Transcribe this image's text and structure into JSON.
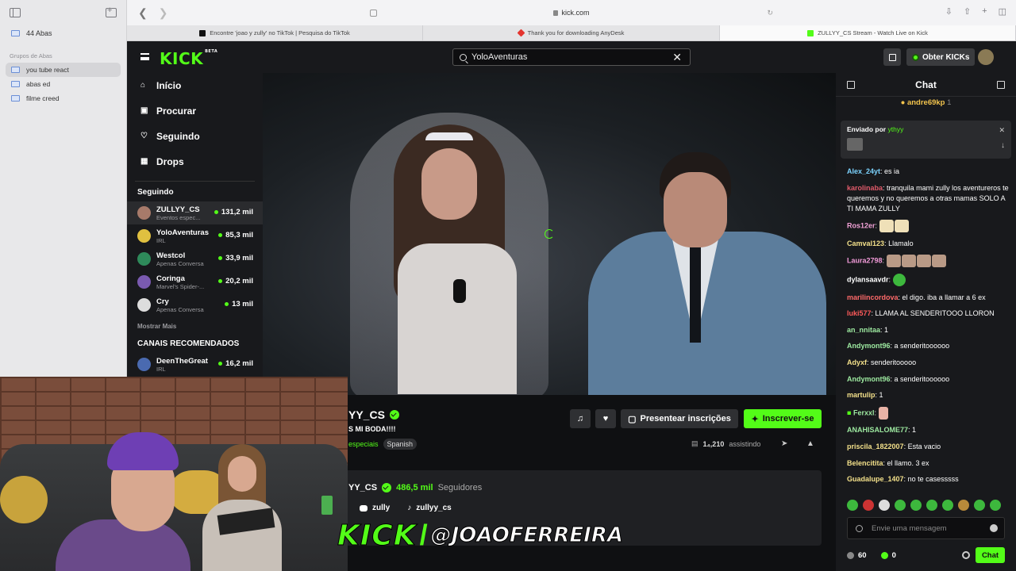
{
  "safari": {
    "tab_count_label": "44 Abas",
    "groups_title": "Grupos de Abas",
    "groups": [
      {
        "label": "you tube react"
      },
      {
        "label": "abas ed"
      },
      {
        "label": "filme creed"
      }
    ],
    "url": "kick.com",
    "tabs": [
      {
        "label": "Encontre 'joao y zully' no TikTok | Pesquisa do TikTok"
      },
      {
        "label": "Thank you for downloading AnyDesk"
      },
      {
        "label": "ZULLYY_CS Stream - Watch Live on Kick"
      }
    ]
  },
  "header": {
    "logo": "KICK",
    "logo_badge": "BETA",
    "search_value": "YoloAventuras",
    "kicks_label": "Obter KICKs"
  },
  "nav": {
    "items": [
      {
        "label": "Início"
      },
      {
        "label": "Procurar"
      },
      {
        "label": "Seguindo"
      },
      {
        "label": "Drops"
      }
    ],
    "following_title": "Seguindo",
    "following": [
      {
        "name": "ZULLYY_CS",
        "category": "Eventos espec...",
        "viewers": "131,2 mil"
      },
      {
        "name": "YoloAventuras",
        "category": "IRL",
        "viewers": "85,3 mil"
      },
      {
        "name": "Westcol",
        "category": "Apenas Conversa",
        "viewers": "33,9 mil"
      },
      {
        "name": "Coringa",
        "category": "Marvel's Spider-...",
        "viewers": "20,2 mil"
      },
      {
        "name": "Cry",
        "category": "Apenas Conversa",
        "viewers": "13 mil"
      }
    ],
    "show_more": "Mostrar Mais",
    "recommended_title": "CANAIS RECOMENDADOS",
    "recommended": [
      {
        "name": "DeenTheGreat",
        "category": "IRL",
        "viewers": "16,2 mil"
      }
    ]
  },
  "stream": {
    "name": "YY_CS",
    "title": "S MI BODA!!!!",
    "category": "especiais",
    "language_tag": "Spanish",
    "gift_label": "Presentear inscrições",
    "subscribe_label": "Inscrever-se",
    "viewers": "1₄,210",
    "viewers_label": "assistindo",
    "about_name": "YY_CS",
    "followers": "486,5 mil",
    "followers_label": "Seguidores",
    "discord": "zully",
    "tiktok": "zullyy_cs"
  },
  "chat": {
    "title": "Chat",
    "top_gifter": "andre69kp",
    "top_gifter_count": "1",
    "pinned_label": "Enviado por",
    "pinned_user": "ythyy",
    "messages": [
      {
        "user": "Alex_24yt",
        "color": "#7cd4ff",
        "text": "es ia"
      },
      {
        "user": "karolinaba",
        "color": "#e05a6a",
        "text": "tranquila mami zully los aventureros te queremos y no queremos a otras mamas SOLO A TI MAMA ZULLY"
      },
      {
        "user": "Ros12er",
        "color": "#f1a1d6",
        "text": ""
      },
      {
        "user": "Camval123",
        "color": "#f3e08a",
        "text": "Llamalo"
      },
      {
        "user": "Laura2798",
        "color": "#f19ad8",
        "text": ""
      },
      {
        "user": "dylansaavdr",
        "color": "#ffffff",
        "text": ""
      },
      {
        "user": "marilincordova",
        "color": "#ff6a6a",
        "text": "el digo. iba a llamar a 6 ex"
      },
      {
        "user": "luki577",
        "color": "#ff5a5a",
        "text": "LLAMA AL SENDERITOOO LLORON"
      },
      {
        "user": "an_nnitaa",
        "color": "#9de9a0",
        "text": "1"
      },
      {
        "user": "Andymont96",
        "color": "#9de9a0",
        "text": "a senderitoooooo"
      },
      {
        "user": "Adyxf",
        "color": "#f3e08a",
        "text": "senderitooooo"
      },
      {
        "user": "Andymont96",
        "color": "#9de9a0",
        "text": "a senderitoooooo"
      },
      {
        "user": "martulip",
        "color": "#f3e08a",
        "text": "1"
      },
      {
        "user": "Ferxxl",
        "color": "#9de9a0",
        "text": ""
      },
      {
        "user": "ANAHISALOME77",
        "color": "#9de9a0",
        "text": "1"
      },
      {
        "user": "priscila_1822007",
        "color": "#f3e08a",
        "text": "Esta vacio"
      },
      {
        "user": "Belencitita",
        "color": "#f3e08a",
        "text": "el llamo. 3 ex"
      },
      {
        "user": "Guadalupe_1407",
        "color": "#f3e08a",
        "text": "no te casesssss"
      }
    ],
    "input_placeholder": "Envie uma mensagem",
    "stat_1": "60",
    "stat_2": "0",
    "send_label": "Chat"
  },
  "watermark": {
    "brand": "KICK",
    "handle": "@JOAOFERREIRA"
  }
}
